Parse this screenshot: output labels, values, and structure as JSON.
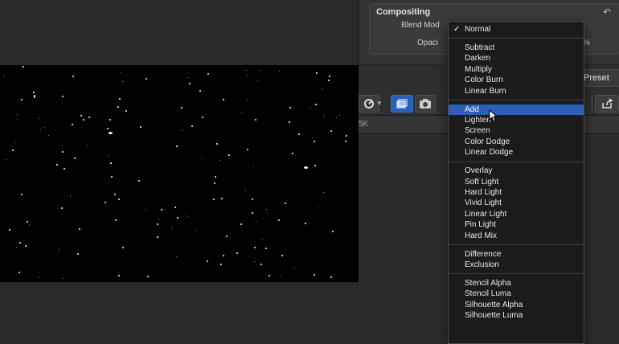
{
  "inspector": {
    "section_title": "Compositing",
    "blend_mode_label": "Blend Mod",
    "opacity_label": "Opaci",
    "opacity_suffix": "%",
    "save_preset_label": "Preset"
  },
  "timeline": {
    "resolution": "5K"
  },
  "blend_menu": {
    "checkmark": "✓",
    "groups": [
      [
        "Normal"
      ],
      [
        "Subtract",
        "Darken",
        "Multiply",
        "Color Burn",
        "Linear Burn"
      ],
      [
        "Add",
        "Lighten",
        "Screen",
        "Color Dodge",
        "Linear Dodge"
      ],
      [
        "Overlay",
        "Soft Light",
        "Hard Light",
        "Vivid Light",
        "Linear Light",
        "Pin Light",
        "Hard Mix"
      ],
      [
        "Difference",
        "Exclusion"
      ],
      [
        "Stencil Alpha",
        "Stencil Luma",
        "Silhouette Alpha",
        "Silhouette Luma"
      ]
    ],
    "checked": "Normal",
    "highlighted": "Add"
  },
  "icons": {
    "reset": "reset-arrow-icon",
    "retime": "retime-icon",
    "transform": "transform-icon",
    "snapshot": "camera-icon",
    "share": "share-icon",
    "cursor": "mouse-pointer-icon"
  },
  "colors": {
    "selection": "#2d5fb4",
    "menu_bg": "#1b1b1b"
  }
}
